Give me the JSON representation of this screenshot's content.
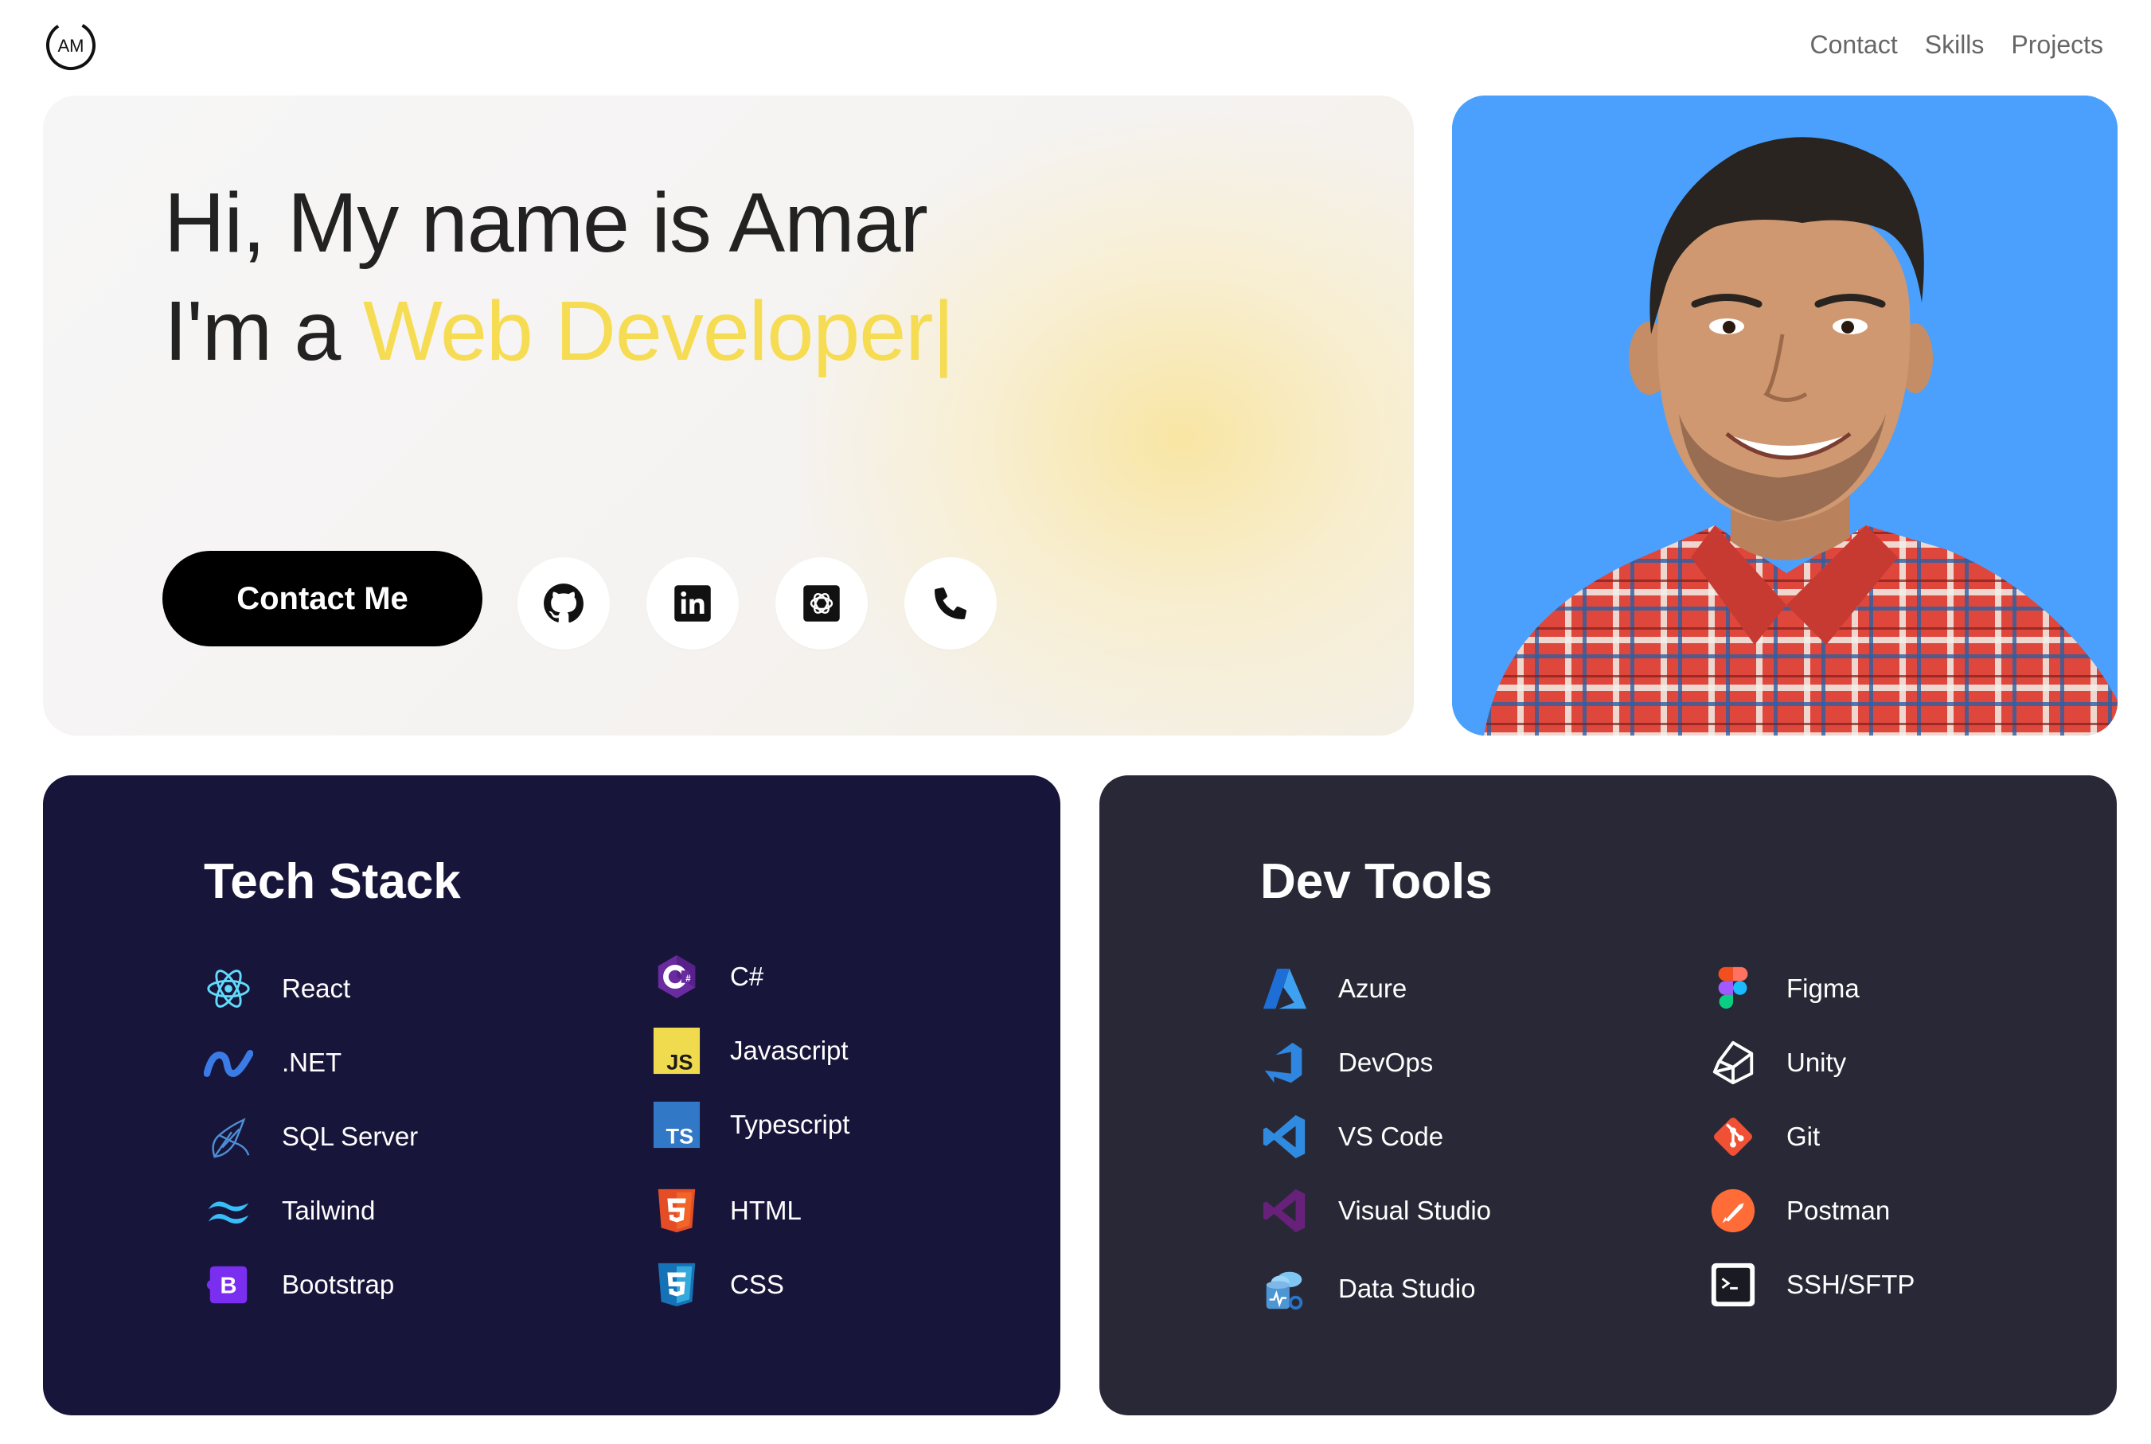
{
  "header": {
    "logo_text": "AM",
    "nav": [
      {
        "label": "Contact"
      },
      {
        "label": "Skills"
      },
      {
        "label": "Projects"
      }
    ]
  },
  "hero": {
    "greeting": "Hi, My name is Amar",
    "role_prefix": "I'm a",
    "role": "Web Developer",
    "cursor": "|",
    "contact_button": "Contact Me",
    "socials": [
      {
        "icon": "github-icon"
      },
      {
        "icon": "linkedin-icon"
      },
      {
        "icon": "openai-icon"
      },
      {
        "icon": "phone-icon"
      }
    ],
    "role_color": "#f6dc52"
  },
  "photo": {
    "background": "#4aa0fc"
  },
  "tech_stack": {
    "title": "Tech Stack",
    "left": [
      {
        "label": "React",
        "icon": "react-icon"
      },
      {
        "label": ".NET",
        "icon": "dotnet-icon"
      },
      {
        "label": "SQL Server",
        "icon": "sql-server-icon"
      },
      {
        "label": "Tailwind",
        "icon": "tailwind-icon"
      },
      {
        "label": "Bootstrap",
        "icon": "bootstrap-icon"
      }
    ],
    "right": [
      {
        "label": "C#",
        "icon": "csharp-icon"
      },
      {
        "label": "Javascript",
        "icon": "javascript-icon"
      },
      {
        "label": "Typescript",
        "icon": "typescript-icon"
      },
      {
        "label": "HTML",
        "icon": "html5-icon"
      },
      {
        "label": "CSS",
        "icon": "css3-icon"
      }
    ]
  },
  "dev_tools": {
    "title": "Dev Tools",
    "left": [
      {
        "label": "Azure",
        "icon": "azure-icon"
      },
      {
        "label": "DevOps",
        "icon": "azure-devops-icon"
      },
      {
        "label": "VS Code",
        "icon": "vscode-icon"
      },
      {
        "label": "Visual Studio",
        "icon": "visual-studio-icon"
      },
      {
        "label": "Data Studio",
        "icon": "data-studio-icon"
      }
    ],
    "right": [
      {
        "label": "Figma",
        "icon": "figma-icon"
      },
      {
        "label": "Unity",
        "icon": "unity-icon"
      },
      {
        "label": "Git",
        "icon": "git-icon"
      },
      {
        "label": "Postman",
        "icon": "postman-icon"
      },
      {
        "label": "SSH/SFTP",
        "icon": "terminal-icon"
      }
    ]
  },
  "colors": {
    "tech_card_bg": "#18153a",
    "dev_card_bg": "#292836",
    "accent_yellow": "#f6dc52"
  }
}
